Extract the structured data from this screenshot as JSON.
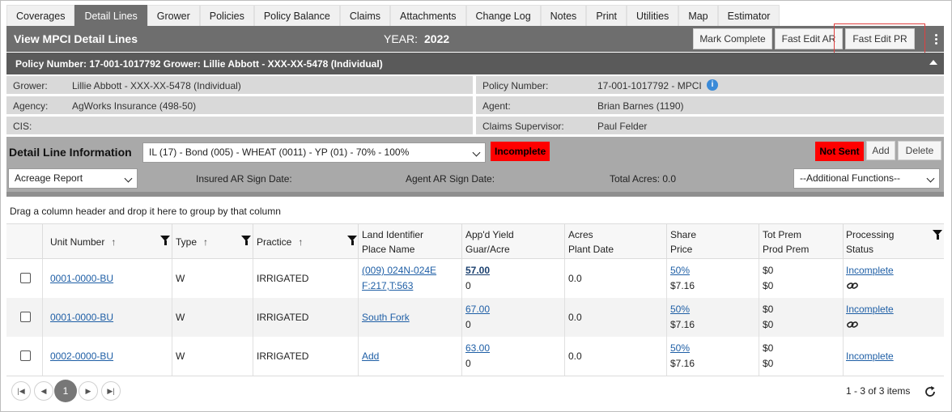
{
  "tabs": [
    "Coverages",
    "Detail Lines",
    "Grower",
    "Policies",
    "Policy Balance",
    "Claims",
    "Attachments",
    "Change Log",
    "Notes",
    "Print",
    "Utilities",
    "Map",
    "Estimator"
  ],
  "active_tab": "Detail Lines",
  "header": {
    "title": "View MPCI Detail Lines",
    "year_label": "YEAR:",
    "year_value": "2022",
    "buttons": {
      "mark_complete": "Mark Complete",
      "fast_edit_ar": "Fast Edit AR",
      "fast_edit_pr": "Fast Edit PR"
    }
  },
  "policy_bar": "Policy Number: 17-001-1017792 Grower: Lillie Abbott - XXX-XX-5478 (Individual)",
  "info": {
    "grower_label": "Grower:",
    "grower": "Lillie Abbott - XXX-XX-5478 (Individual)",
    "policy_label": "Policy Number:",
    "policy": "17-001-1017792 - MPCI",
    "agency_label": "Agency:",
    "agency": "AgWorks Insurance (498-50)",
    "agent_label": "Agent:",
    "agent": "Brian Barnes (1190)",
    "cis_label": "CIS:",
    "cis": "",
    "supervisor_label": "Claims Supervisor:",
    "supervisor": "Paul Felder"
  },
  "detail": {
    "title": "Detail Line Information",
    "line_select": "IL (17) - Bond (005) - WHEAT (0011) - YP (01) - 70% - 100%",
    "status_badge": "Incomplete",
    "sent_badge": "Not Sent",
    "add_label": "Add",
    "delete_label": "Delete",
    "report_select": "Acreage Report",
    "insured_sign": "Insured AR Sign Date:",
    "agent_sign": "Agent AR Sign Date:",
    "total_acres": "Total Acres: 0.0",
    "additional_functions": "--Additional Functions--"
  },
  "group_hint": "Drag a column header and drop it here to group by that column",
  "columns": {
    "unit": "Unit Number",
    "type": "Type",
    "practice": "Practice",
    "land1": "Land Identifier",
    "land2": "Place Name",
    "yield1": "App'd Yield",
    "yield2": "Guar/Acre",
    "acres1": "Acres",
    "acres2": "Plant Date",
    "share1": "Share",
    "share2": "Price",
    "prem1": "Tot Prem",
    "prem2": "Prod Prem",
    "proc1": "Processing",
    "proc2": "Status"
  },
  "rows": [
    {
      "unit": "0001-0000-BU",
      "type": "W",
      "practice": "IRRIGATED",
      "land1": "(009) 024N-024E",
      "land2": "F:217,T:563",
      "yield": "57.00",
      "guar": "0",
      "acres": "0.0",
      "share": "50%",
      "price": "$7.16",
      "totprem": "$0",
      "prodprem": "$0",
      "status": "Incomplete",
      "link_icon": "chain-link-icon"
    },
    {
      "unit": "0001-0000-BU",
      "type": "W",
      "practice": "IRRIGATED",
      "land1": "South Fork",
      "land2": "",
      "yield": "67.00",
      "guar": "0",
      "acres": "0.0",
      "share": "50%",
      "price": "$7.16",
      "totprem": "$0",
      "prodprem": "$0",
      "status": "Incomplete",
      "link_icon": "chain-link-icon"
    },
    {
      "unit": "0002-0000-BU",
      "type": "W",
      "practice": "IRRIGATED",
      "land1": "Add",
      "land2": "",
      "yield": "63.00",
      "guar": "0",
      "acres": "0.0",
      "share": "50%",
      "price": "$7.16",
      "totprem": "$0",
      "prodprem": "$0",
      "status": "Incomplete",
      "link_icon": ""
    }
  ],
  "pager": {
    "current_page": "1",
    "info": "1 - 3 of 3 items"
  },
  "colors": {
    "header_gray": "#6e6e6e",
    "policy_gray": "#5a5a5a",
    "info_gray": "#d9d9d9",
    "detail_gray": "#a9a9a9",
    "alert_red": "#ff0000",
    "link_blue": "#1f5fa6",
    "highlight_red": "#e0403f"
  }
}
